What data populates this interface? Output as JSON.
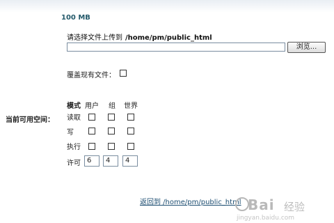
{
  "quota": "100 MB",
  "upload": {
    "label": "请选择文件上传到",
    "path": "/home/pm/public_html",
    "file_value": "",
    "browse_label": "浏览..."
  },
  "overwrite": {
    "label": "覆盖现有文件：",
    "checked": false
  },
  "space_label": "当前可用空间：",
  "permissions": {
    "headers": {
      "mode": "模式",
      "user": "用户",
      "group": "组",
      "world": "世界"
    },
    "rows": [
      {
        "label": "读取",
        "user": false,
        "group": false,
        "world": false
      },
      {
        "label": "写",
        "user": false,
        "group": false,
        "world": false
      },
      {
        "label": "执行",
        "user": false,
        "group": false,
        "world": false
      }
    ],
    "allow": {
      "label": "许可",
      "user": "6",
      "group": "4",
      "world": "4"
    }
  },
  "back_link": "返回到  /home/pm/public_html",
  "watermark": {
    "brand": "Bai",
    "brand_suffix": "经验",
    "url": "jingyan.baidu.com"
  }
}
